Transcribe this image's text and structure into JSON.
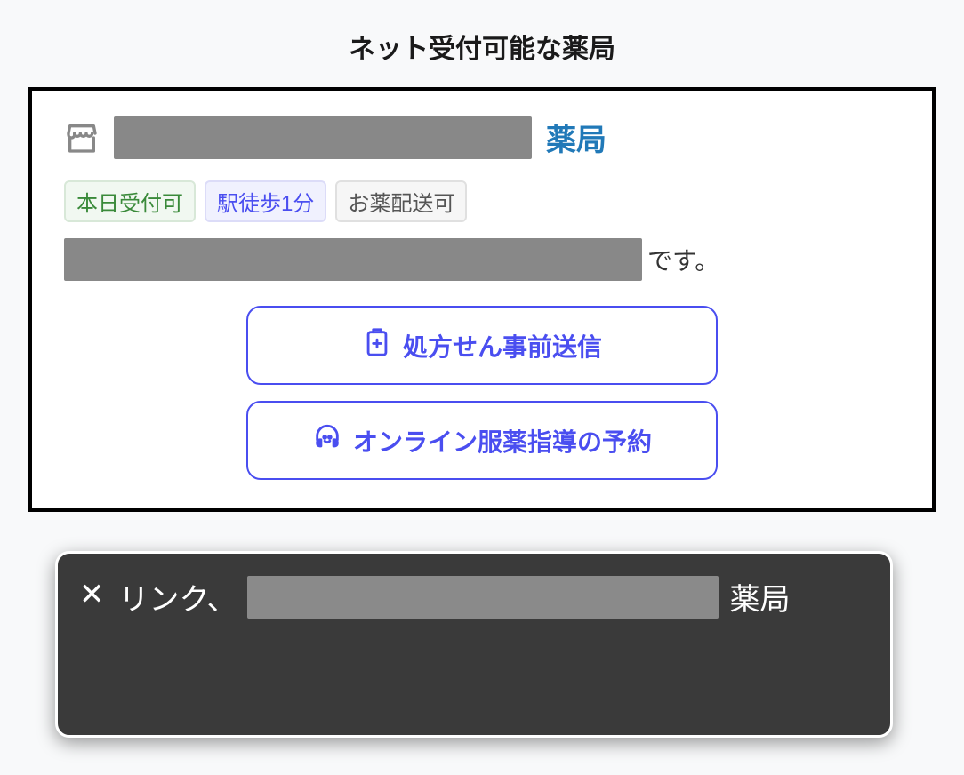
{
  "page_title": "ネット受付可能な薬局",
  "pharmacy": {
    "name_suffix": "薬局",
    "tags": [
      {
        "label": "本日受付可",
        "style": "green"
      },
      {
        "label": "駅徒歩1分",
        "style": "blue"
      },
      {
        "label": "お薬配送可",
        "style": "gray"
      }
    ],
    "description_suffix": "です。",
    "actions": {
      "prescription_send": "処方せん事前送信",
      "online_guidance": "オンライン服薬指導の予約"
    }
  },
  "screen_reader_overlay": {
    "close_symbol": "✕",
    "prefix": "リンク、",
    "suffix": "薬局"
  }
}
